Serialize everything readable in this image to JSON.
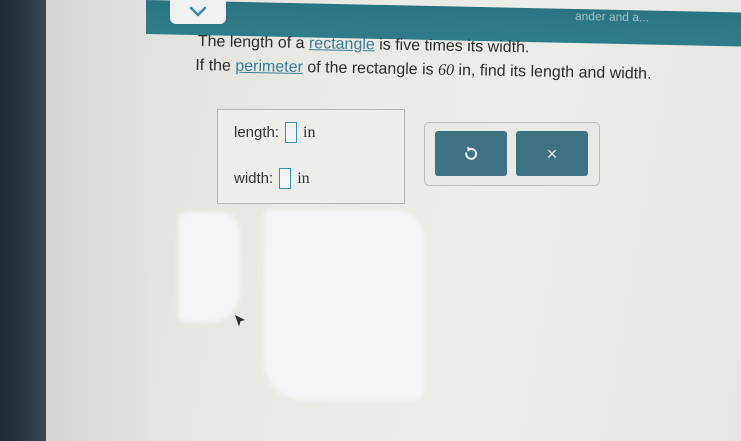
{
  "header": {
    "partial_text": "ander and a..."
  },
  "problem": {
    "line1_before": "The length of a ",
    "line1_link": "rectangle",
    "line1_after": " is five times its width.",
    "line2_before": "If the ",
    "line2_link": "perimeter",
    "line2_middle": " of the rectangle is ",
    "line2_value": "60",
    "line2_after": " in, find its length and width."
  },
  "answer": {
    "length_label": "length:",
    "length_unit": "in",
    "width_label": "width:",
    "width_unit": "in"
  },
  "actions": {
    "clear_glyph": "×"
  },
  "colors": {
    "topbar": "#2f7d88",
    "link": "#3c7d94",
    "button": "#3f7381",
    "input_border": "#3b8fb8"
  }
}
